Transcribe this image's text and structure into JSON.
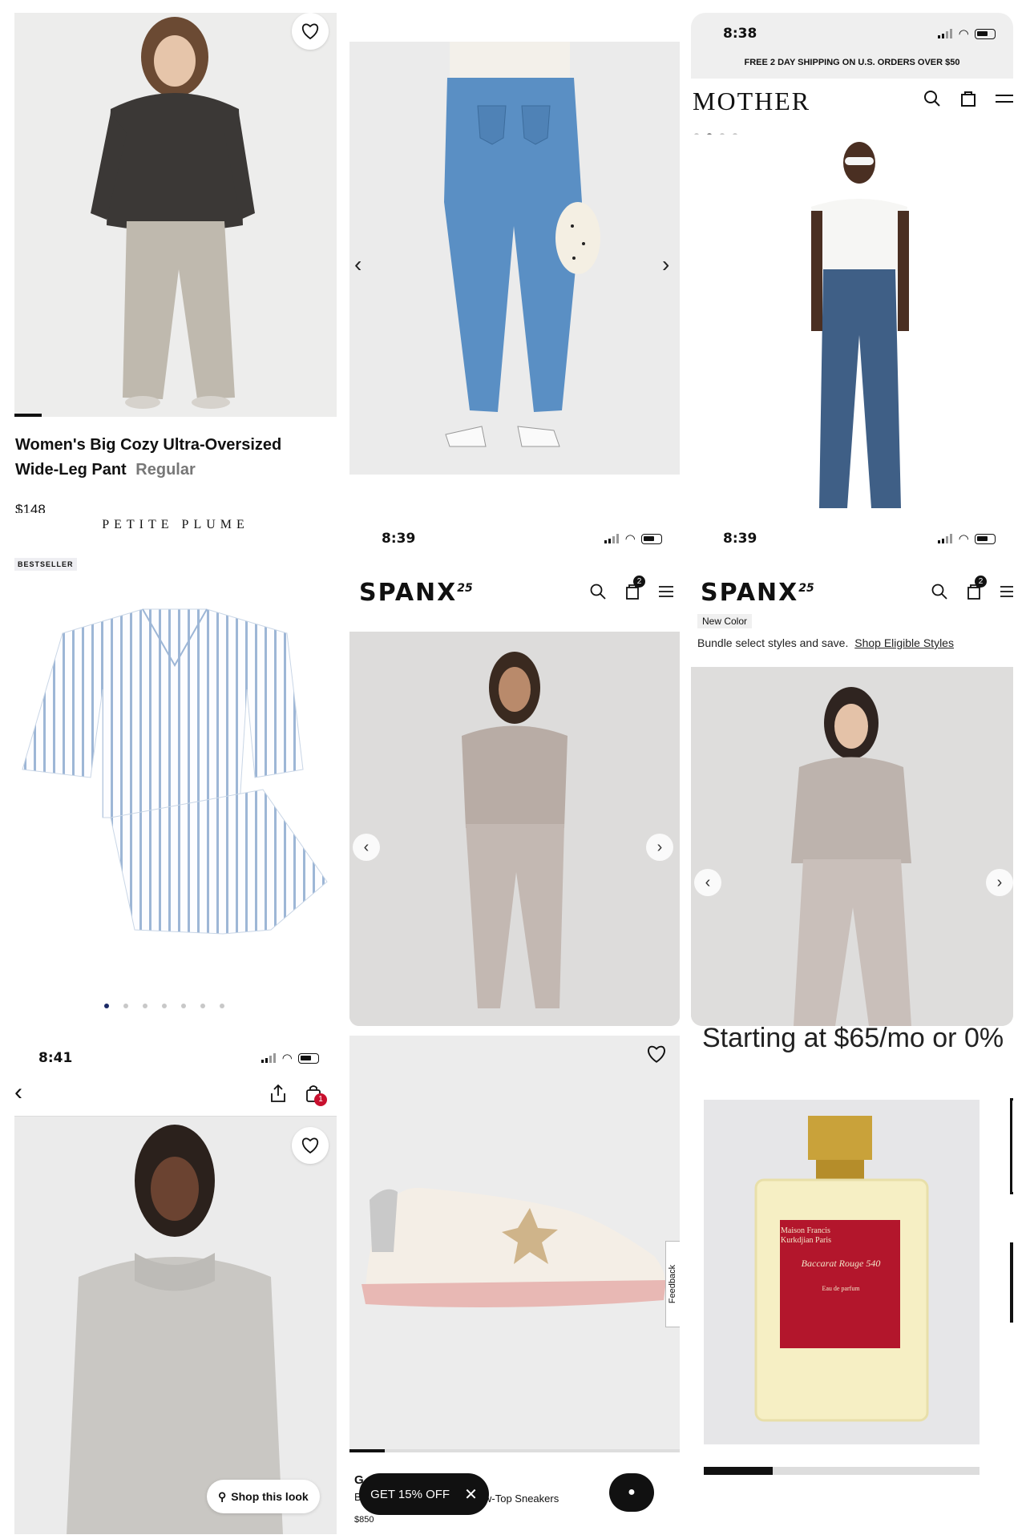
{
  "tile1": {
    "title_line1": "Women's Big Cozy Ultra-Oversized",
    "title_line2": "Wide-Leg Pant",
    "fit": "Regular",
    "price": "$148"
  },
  "tile3": {
    "time": "8:38",
    "banner": "FREE 2 DAY SHIPPING ON U.S. ORDERS OVER $50",
    "brand": "MOTHER"
  },
  "tile4": {
    "brand": "PETITE PLUME",
    "badge": "BESTSELLER",
    "dot_count": 7,
    "active_dot": 1
  },
  "tile5": {
    "time": "8:39",
    "brand": "SPANX",
    "brand_sup": "25",
    "cart_count": "2"
  },
  "tile6": {
    "time": "8:39",
    "brand": "SPANX",
    "brand_sup": "25",
    "cart_count": "2",
    "new_color": "New Color",
    "bundle_text": "Bundle select styles and save.",
    "bundle_link": "Shop Eligible Styles"
  },
  "tile7": {
    "time": "8:41",
    "cart_count": "1",
    "shop_look": "Shop this look"
  },
  "tile8": {
    "feedback": "Feedback",
    "promo": "GET 15% OFF",
    "partial_title_start": "G",
    "partial_brand_start": "B",
    "partial_title_end": "w-Top Sneakers",
    "price_partial": "$850"
  },
  "tile9": {
    "financing_text": "Starting at $65/mo or 0%",
    "bottle_brand": "Maison Francis Kurkdjian Paris",
    "bottle_name": "Baccarat Rouge 540",
    "bottle_type": "Eau de parfum",
    "progress": 0.25
  },
  "colors": {
    "accent_red": "#c8102e",
    "dot_active": "#1b2a66",
    "promo_bg": "#111111"
  }
}
